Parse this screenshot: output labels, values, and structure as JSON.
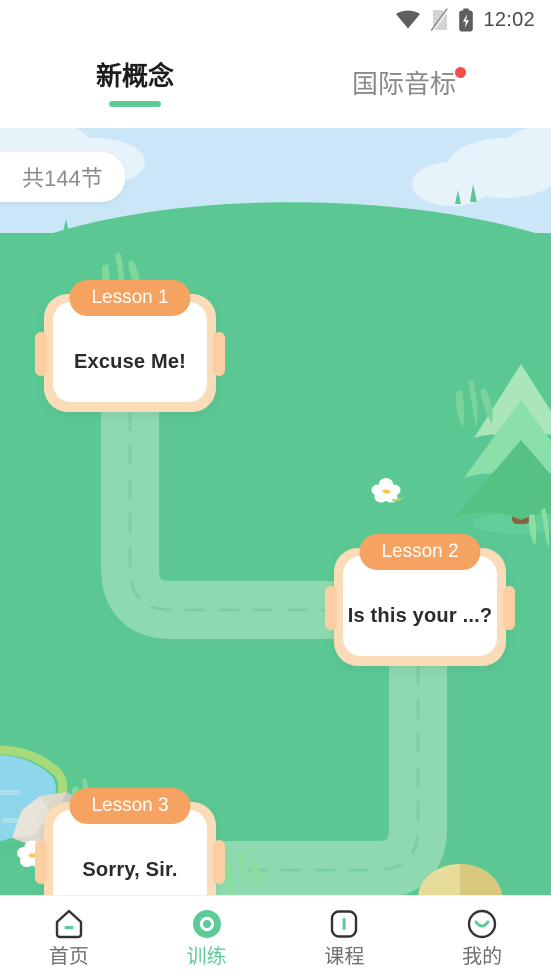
{
  "status_bar": {
    "time": "12:02",
    "icons": [
      "wifi-icon",
      "sim-off-icon",
      "battery-charging-icon"
    ]
  },
  "top_tabs": {
    "items": [
      {
        "label": "新概念",
        "active": true,
        "badge": false
      },
      {
        "label": "国际音标",
        "active": false,
        "badge": true
      }
    ],
    "active_indicator_color": "#5ecb96",
    "badge_color": "#fa4b4b"
  },
  "scene": {
    "count_badge": "共144节",
    "colors": {
      "sky": "#cbe7f7",
      "cloud": "#e2f1fb",
      "grass": "#5bc894",
      "path": "#8fd9b0",
      "path_dash": "#7ccfa2",
      "pond": "#7fd3ea",
      "pond_shore": "#a8d97a",
      "rock": "#ded9cd",
      "tree_light": "#abe6ba",
      "tree_mid": "#7fd79c",
      "tree_dark": "#55c182",
      "trunk": "#8a6242",
      "flower_center": "#f3cb4d",
      "card_frame": "#fbdcb9",
      "card_pill": "#f6a361"
    }
  },
  "lessons": [
    {
      "pill": "Lesson 1",
      "title": "Excuse Me!"
    },
    {
      "pill": "Lesson 2",
      "title": "Is this your ...?"
    },
    {
      "pill": "Lesson 3",
      "title": "Sorry, Sir."
    }
  ],
  "bottom_nav": {
    "items": [
      {
        "label": "首页",
        "icon": "home-icon",
        "active": false
      },
      {
        "label": "训练",
        "icon": "training-icon",
        "active": true
      },
      {
        "label": "课程",
        "icon": "course-icon",
        "active": false
      },
      {
        "label": "我的",
        "icon": "profile-icon",
        "active": false
      }
    ],
    "active_color": "#5ecb96",
    "inactive_color": "#6f6f6f"
  }
}
